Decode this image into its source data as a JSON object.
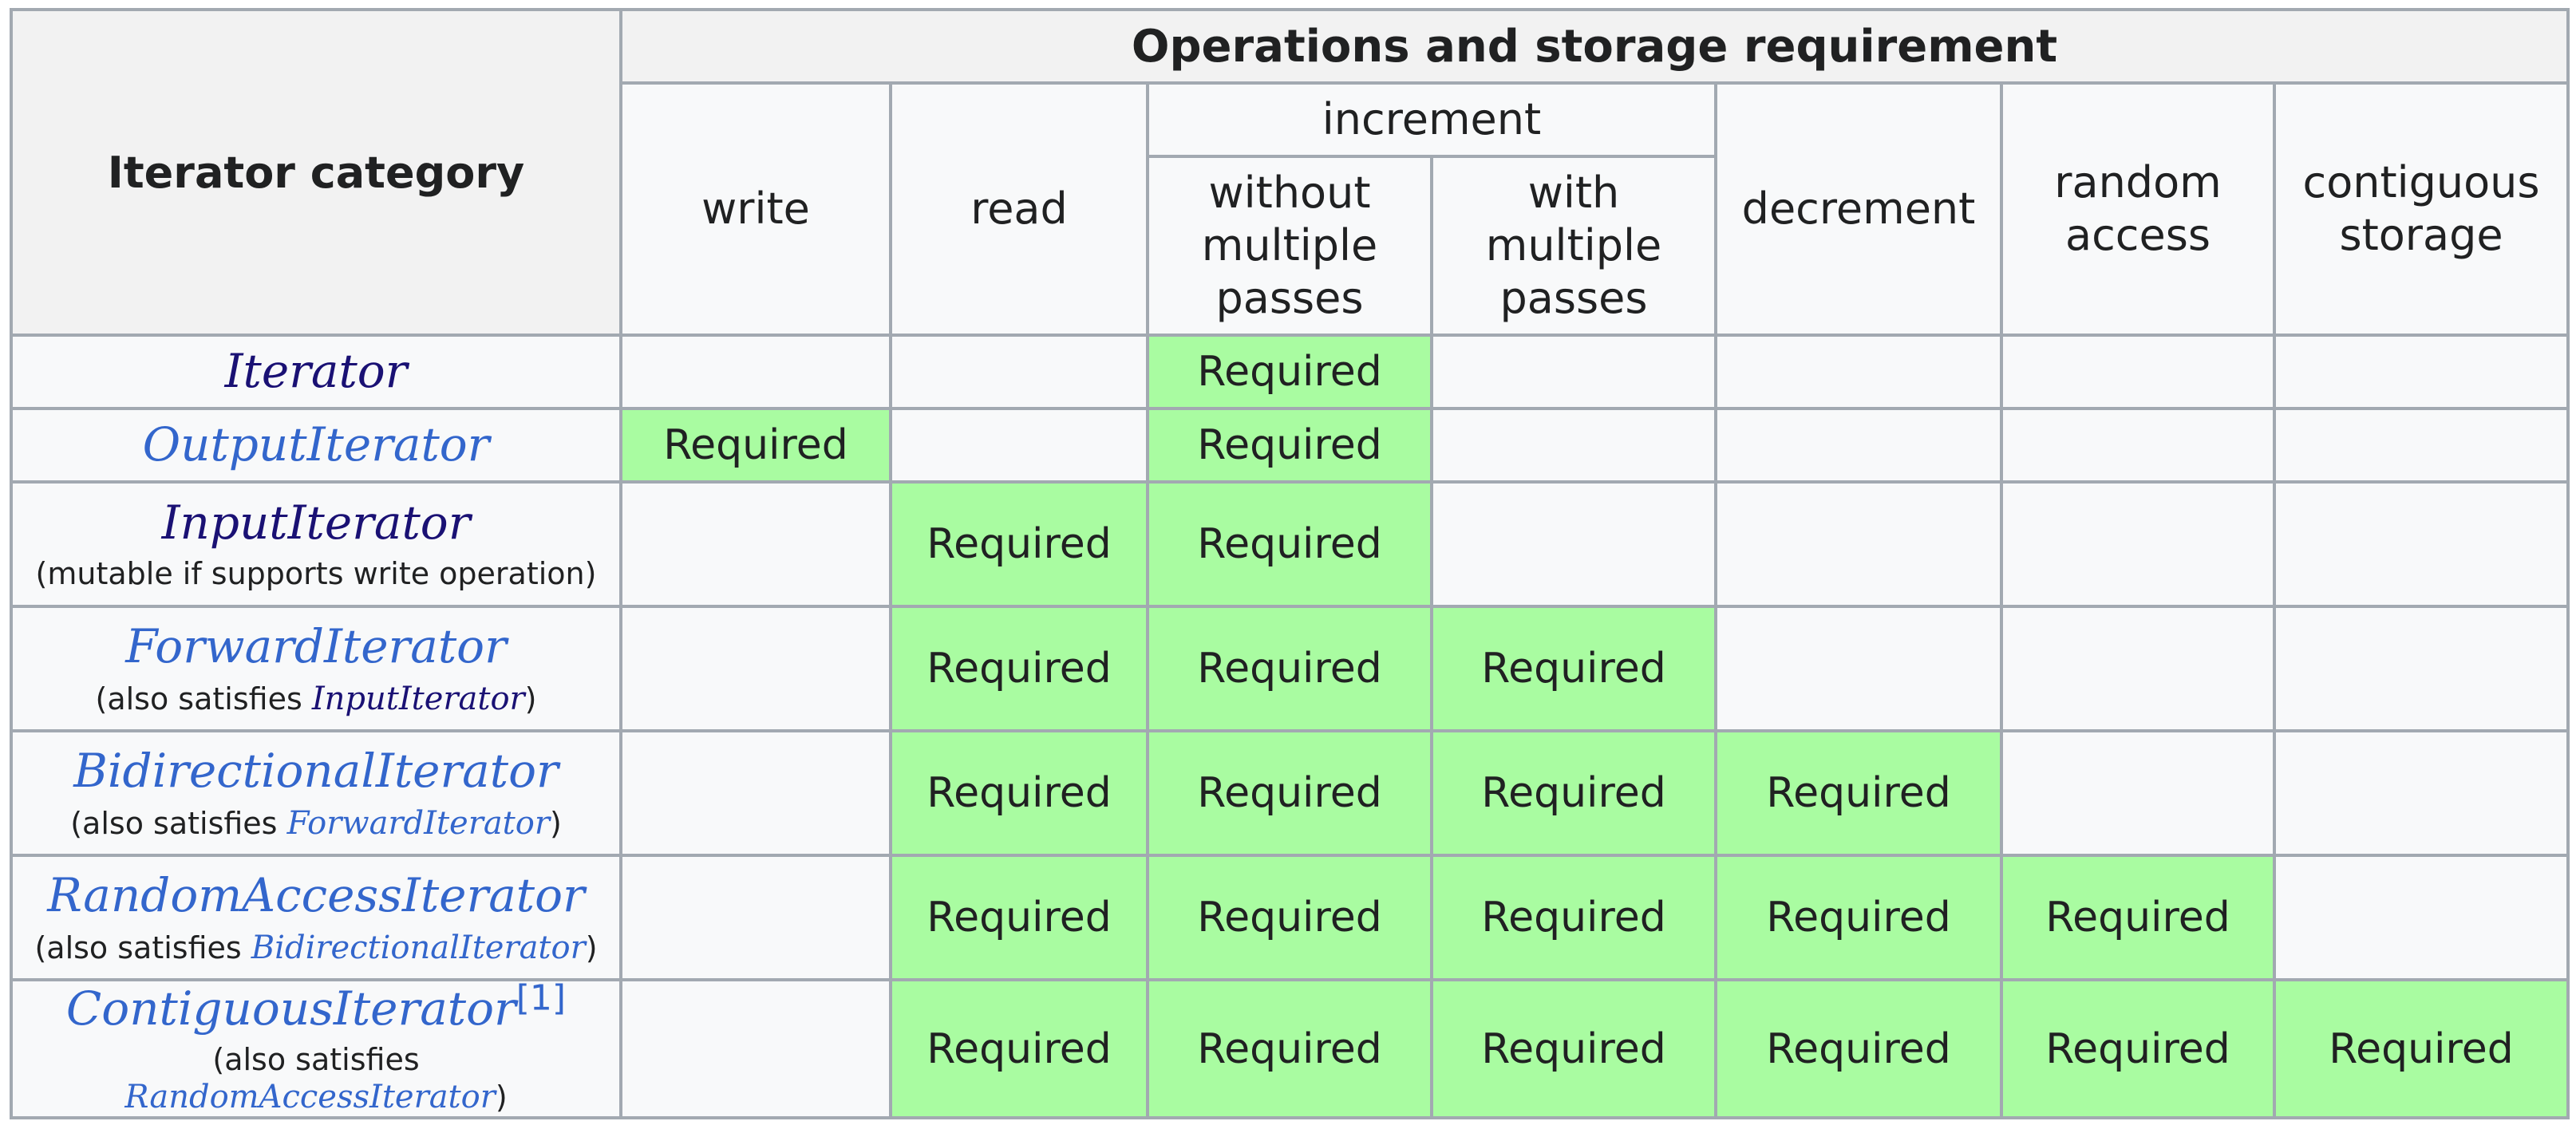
{
  "header": {
    "category_label": "Iterator category",
    "group_label": "Operations and storage requirement",
    "increment_label": "increment",
    "columns": {
      "write": "write",
      "read": "read",
      "without_multiple": "without\nmultiple\npasses",
      "with_multiple": "with\nmultiple\npasses",
      "decrement": "decrement",
      "random_access": "random\naccess",
      "contiguous": "contiguous\nstorage"
    }
  },
  "colors": {
    "required": "#a9fca1",
    "empty": "#f8f9fa",
    "link": "#3366cc",
    "visited_link": "#1a1174",
    "border": "#a2a9b1"
  },
  "rows": [
    {
      "name": "Iterator",
      "note_prefix": "",
      "note_ref": "",
      "note_suffix": "",
      "footnote": "",
      "cells": [
        "",
        "",
        "Required",
        "",
        "",
        "",
        ""
      ]
    },
    {
      "name": "OutputIterator",
      "note_prefix": "",
      "note_ref": "",
      "note_suffix": "",
      "footnote": "",
      "cells": [
        "Required",
        "",
        "Required",
        "",
        "",
        "",
        ""
      ]
    },
    {
      "name": "InputIterator",
      "note_prefix": "(mutable if supports write operation)",
      "note_ref": "",
      "note_suffix": "",
      "footnote": "",
      "cells": [
        "",
        "Required",
        "Required",
        "",
        "",
        "",
        ""
      ]
    },
    {
      "name": "ForwardIterator",
      "note_prefix": "(also satisfies ",
      "note_ref": "InputIterator",
      "note_suffix": ")",
      "footnote": "",
      "cells": [
        "",
        "Required",
        "Required",
        "Required",
        "",
        "",
        ""
      ]
    },
    {
      "name": "BidirectionalIterator",
      "note_prefix": "(also satisfies ",
      "note_ref": "ForwardIterator",
      "note_suffix": ")",
      "footnote": "",
      "cells": [
        "",
        "Required",
        "Required",
        "Required",
        "Required",
        "",
        ""
      ]
    },
    {
      "name": "RandomAccessIterator",
      "note_prefix": "(also satisfies ",
      "note_ref": "BidirectionalIterator",
      "note_suffix": ")",
      "footnote": "",
      "cells": [
        "",
        "Required",
        "Required",
        "Required",
        "Required",
        "Required",
        ""
      ]
    },
    {
      "name": "ContiguousIterator",
      "note_prefix": "(also satisfies ",
      "note_ref": "RandomAccessIterator",
      "note_suffix": ")",
      "footnote": "[1]",
      "cells": [
        "",
        "Required",
        "Required",
        "Required",
        "Required",
        "Required",
        "Required"
      ]
    }
  ]
}
